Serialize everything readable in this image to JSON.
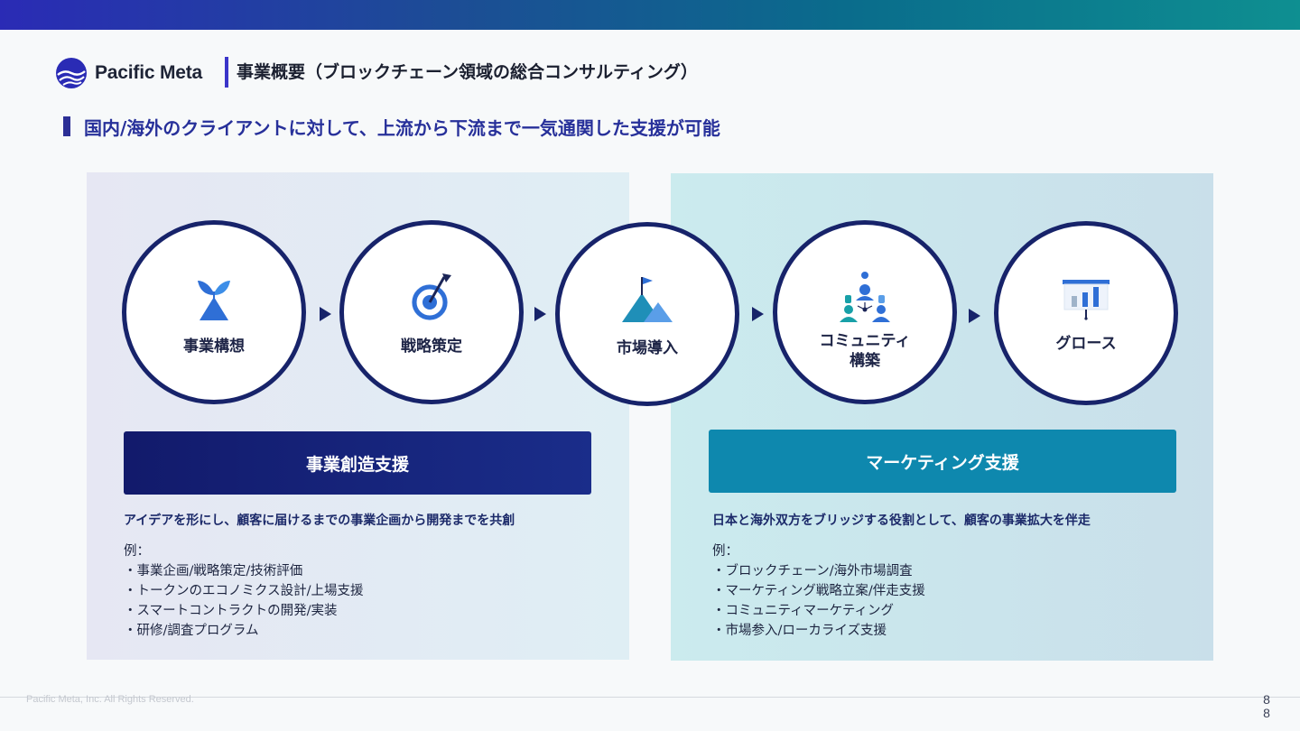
{
  "header": {
    "logo_text": "Pacific Meta",
    "page_title": "事業概要（ブロックチェーン領域の総合コンサルティング）",
    "subtitle": "国内/海外のクライアントに対して、上流から下流まで一気通関した支援が可能"
  },
  "steps": [
    {
      "label": "事業構想",
      "icon": "sprout-icon"
    },
    {
      "label": "戦略策定",
      "icon": "target-icon"
    },
    {
      "label": "市場導入",
      "icon": "mountain-flag-icon"
    },
    {
      "label_line1": "コミュニティ",
      "label_line2": "構築",
      "icon": "community-icon"
    },
    {
      "label": "グロース",
      "icon": "bar-chart-icon"
    }
  ],
  "left_section": {
    "title": "事業創造支援",
    "description": "アイデアを形にし、顧客に届けるまでの事業企画から開発までを共創",
    "example_label": "例：",
    "examples": [
      "・事業企画/戦略策定/技術評価",
      "・トークンのエコノミクス設計/上場支援",
      "・スマートコントラクトの開発/実装",
      "・研修/調査プログラム"
    ]
  },
  "right_section": {
    "title": "マーケティング支援",
    "description": "日本と海外双方をブリッジする役割として、顧客の事業拡大を伴走",
    "example_label": "例：",
    "examples": [
      "・ブロックチェーン/海外市場調査",
      "・マーケティング戦略立案/伴走支援",
      "・コミュニティマーケティング",
      "・市場参入/ローカライズ支援"
    ]
  },
  "footer": {
    "copyright": "Pacific Meta, Inc. All Rights Reserved.",
    "page_number_top": "8",
    "page_number_bottom": "8"
  },
  "colors": {
    "navy": "#17236a",
    "accent_blue": "#2f6fd6",
    "teal_band": "#0e88ae",
    "navy_band": "#121a6b"
  }
}
